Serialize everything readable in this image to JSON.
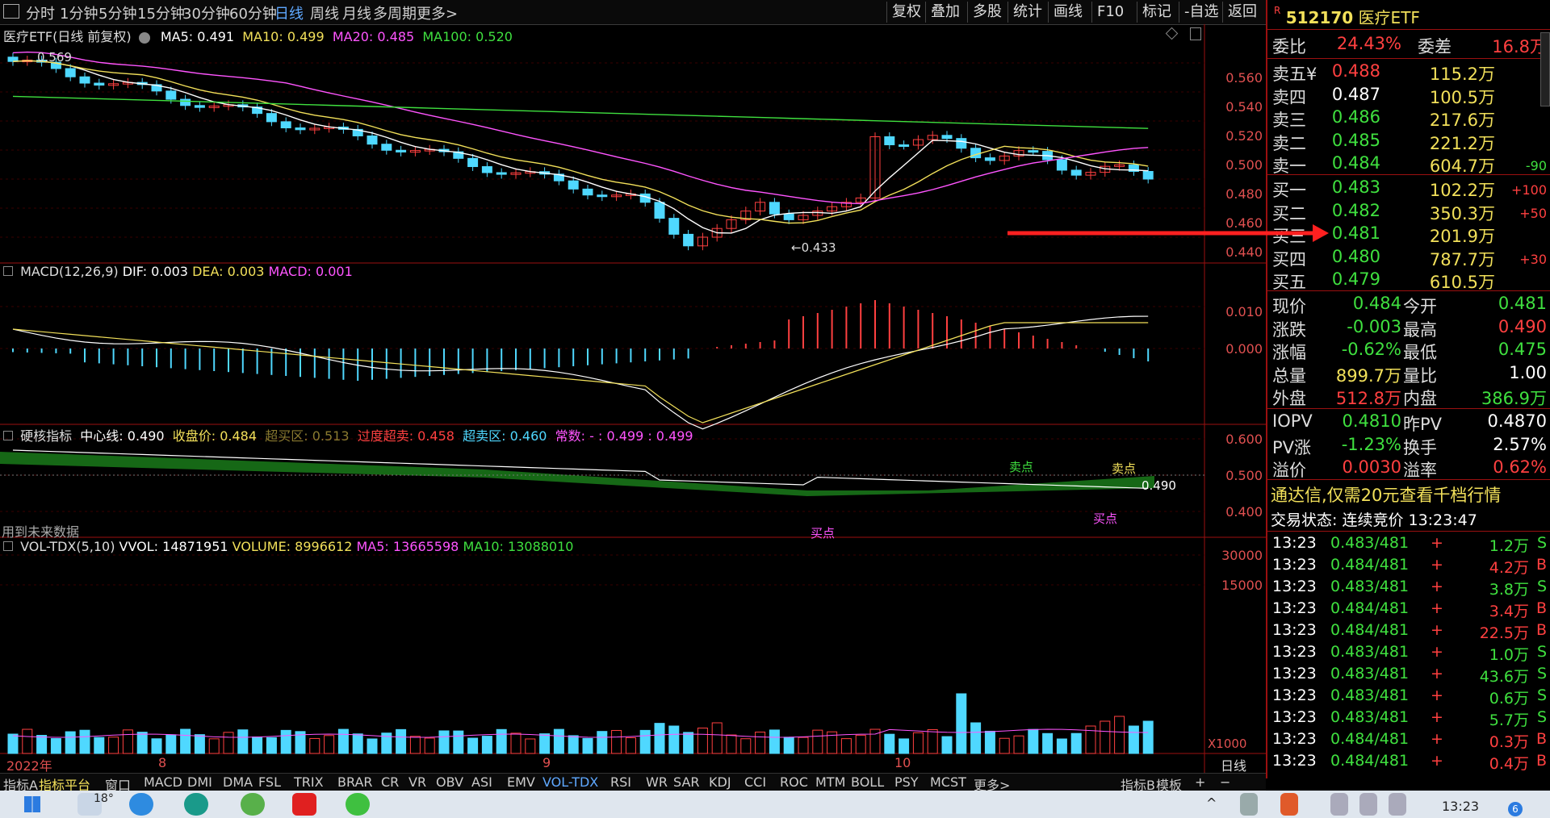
{
  "toolbar": {
    "periods": [
      "分时",
      "1分钟",
      "5分钟",
      "15分钟",
      "30分钟",
      "60分钟",
      "日线",
      "周线",
      "月线",
      "多周期",
      "更多>"
    ],
    "active_period": "日线",
    "right_buttons": [
      "复权",
      "叠加",
      "多股",
      "统计",
      "画线",
      "F10",
      "标记",
      "-自选",
      "返回"
    ]
  },
  "main_chart": {
    "title": "医疗ETF(日线 前复权)",
    "ma5": "MA5: 0.491",
    "ma10": "MA10: 0.499",
    "ma20": "MA20: 0.485",
    "ma100": "MA100: 0.520",
    "high_mark": "0.569",
    "low_mark": "0.433",
    "y_ticks": [
      "0.560",
      "0.540",
      "0.520",
      "0.500",
      "0.480",
      "0.460",
      "0.440"
    ]
  },
  "macd": {
    "title": "MACD(12,26,9)",
    "dif": "DIF: 0.003",
    "dea": "DEA: 0.003",
    "macd": "MACD: 0.001",
    "y_ticks": [
      "0.010",
      "0.000"
    ]
  },
  "hardcore": {
    "title": "硬核指标",
    "center": "中心线: 0.490",
    "close": "收盘价: 0.484",
    "overbought": "超买区: 0.513",
    "excess_oversold": "过度超卖: 0.458",
    "oversold": "超卖区: 0.460",
    "constant": "常数: - : 0.499 : 0.499",
    "future_note": "用到未来数据",
    "sell1": "卖点",
    "sell2": "卖点",
    "buy1": "买点",
    "buy2": "买点",
    "last_value": "0.490",
    "y_ticks": [
      "0.600",
      "0.500",
      "0.400"
    ]
  },
  "volume": {
    "title": "VOL-TDX(5,10)",
    "vvol": "VVOL: 14871951",
    "volume": "VOLUME: 8996612",
    "ma5": "MA5: 13665598",
    "ma10": "MA10: 13088010",
    "y_ticks": [
      "30000",
      "15000"
    ],
    "unit": "X1000"
  },
  "x_axis": {
    "labels": [
      "2022年",
      "8",
      "9",
      "10"
    ],
    "period": "日线"
  },
  "indicator_tabs": [
    "指标A",
    "指标平台",
    "窗口",
    "MACD",
    "DMI",
    "DMA",
    "FSL",
    "TRIX",
    "BRAR",
    "CR",
    "VR",
    "OBV",
    "ASI",
    "EMV",
    "VOL-TDX",
    "RSI",
    "WR",
    "SAR",
    "KDJ",
    "CCI",
    "ROC",
    "MTM",
    "BOLL",
    "PSY",
    "MCST",
    "更多>",
    "指标B",
    "模板",
    "+",
    "−"
  ],
  "quote": {
    "code": "512170",
    "name": "医疗ETF",
    "weibi_label": "委比",
    "weibi": "24.43%",
    "weicha_label": "委差",
    "weicha": "16.8万",
    "asks": [
      {
        "label": "卖五¥",
        "price": "0.488",
        "vol": "115.2万",
        "chg": ""
      },
      {
        "label": "卖四",
        "price": "0.487",
        "vol": "100.5万",
        "chg": ""
      },
      {
        "label": "卖三",
        "price": "0.486",
        "vol": "217.6万",
        "chg": ""
      },
      {
        "label": "卖二",
        "price": "0.485",
        "vol": "221.2万",
        "chg": ""
      },
      {
        "label": "卖一",
        "price": "0.484",
        "vol": "604.7万",
        "chg": "-90"
      }
    ],
    "bids": [
      {
        "label": "买一",
        "price": "0.483",
        "vol": "102.2万",
        "chg": "+100"
      },
      {
        "label": "买二",
        "price": "0.482",
        "vol": "350.3万",
        "chg": "+50"
      },
      {
        "label": "买三",
        "price": "0.481",
        "vol": "201.9万",
        "chg": ""
      },
      {
        "label": "买四",
        "price": "0.480",
        "vol": "787.7万",
        "chg": "+30"
      },
      {
        "label": "买五",
        "price": "0.479",
        "vol": "610.5万",
        "chg": ""
      }
    ],
    "stats": [
      {
        "l1": "现价",
        "v1": "0.484",
        "l2": "今开",
        "v2": "0.481"
      },
      {
        "l1": "涨跌",
        "v1": "-0.003",
        "l2": "最高",
        "v2": "0.490"
      },
      {
        "l1": "涨幅",
        "v1": "-0.62%",
        "l2": "最低",
        "v2": "0.475"
      },
      {
        "l1": "总量",
        "v1": "899.7万",
        "l2": "量比",
        "v2": "1.00"
      },
      {
        "l1": "外盘",
        "v1": "512.8万",
        "l2": "内盘",
        "v2": "386.9万"
      }
    ],
    "etf": [
      {
        "l1": "IOPV",
        "v1": "0.4810",
        "l2": "昨PV",
        "v2": "0.4870"
      },
      {
        "l1": "PV涨",
        "v1": "-1.23%",
        "l2": "换手",
        "v2": "2.57%"
      },
      {
        "l1": "溢价",
        "v1": "0.0030",
        "l2": "溢率",
        "v2": "0.62%"
      }
    ],
    "ad_text": "通达信,仅需20元查看千档行情",
    "status": "交易状态: 连续竞价 13:23:47",
    "ticks": [
      {
        "t": "13:23",
        "p": "0.483/481",
        "a": "+",
        "v": "1.2万",
        "s": "S"
      },
      {
        "t": "13:23",
        "p": "0.484/481",
        "a": "+",
        "v": "4.2万",
        "s": "B"
      },
      {
        "t": "13:23",
        "p": "0.483/481",
        "a": "+",
        "v": "3.8万",
        "s": "S"
      },
      {
        "t": "13:23",
        "p": "0.484/481",
        "a": "+",
        "v": "3.4万",
        "s": "B"
      },
      {
        "t": "13:23",
        "p": "0.484/481",
        "a": "+",
        "v": "22.5万",
        "s": "B"
      },
      {
        "t": "13:23",
        "p": "0.483/481",
        "a": "+",
        "v": "1.0万",
        "s": "S"
      },
      {
        "t": "13:23",
        "p": "0.483/481",
        "a": "+",
        "v": "43.6万",
        "s": "S"
      },
      {
        "t": "13:23",
        "p": "0.483/481",
        "a": "+",
        "v": "0.6万",
        "s": "S"
      },
      {
        "t": "13:23",
        "p": "0.483/481",
        "a": "+",
        "v": "5.7万",
        "s": "S"
      },
      {
        "t": "13:23",
        "p": "0.484/481",
        "a": "+",
        "v": "0.3万",
        "s": "B"
      },
      {
        "t": "13:23",
        "p": "0.484/481",
        "a": "+",
        "v": "0.4万",
        "s": "B"
      }
    ]
  },
  "taskbar": {
    "weather": "18°",
    "time": "13:23",
    "notif": "6"
  },
  "colors": {
    "up": "#ff4040",
    "down": "#4fd8ff",
    "ma5": "#ffffff",
    "ma10": "#f2e05a",
    "ma20": "#ff55ff",
    "ma100": "#3fe03f"
  }
}
